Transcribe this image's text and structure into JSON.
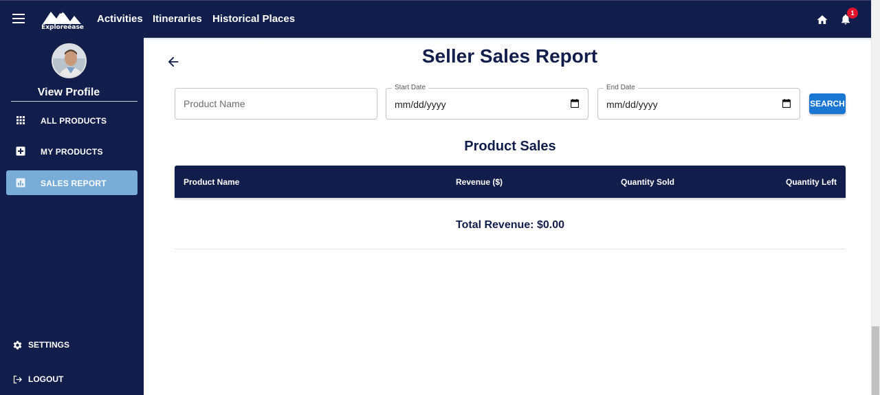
{
  "header": {
    "logo_text": "Exploreéase",
    "nav": [
      "Activities",
      "Itineraries",
      "Historical Places"
    ],
    "notification_count": "1"
  },
  "sidebar": {
    "profile_label": "View Profile",
    "items": [
      {
        "label": "ALL PRODUCTS",
        "icon": "grid-icon"
      },
      {
        "label": "MY PRODUCTS",
        "icon": "add-box-icon"
      },
      {
        "label": "SALES REPORT",
        "icon": "bar-chart-icon",
        "active": true
      }
    ],
    "settings_label": "SETTINGS",
    "logout_label": "LOGOUT"
  },
  "main": {
    "title": "Seller Sales Report",
    "filters": {
      "product_placeholder": "Product Name",
      "start_label": "Start Date",
      "start_value": "mm/dd/yyyy",
      "end_label": "End Date",
      "end_value": "mm/dd/yyyy",
      "search_label": "SEARCH"
    },
    "section_title": "Product Sales",
    "columns": [
      "Product Name",
      "Revenue ($)",
      "Quantity Sold",
      "Quantity Left"
    ],
    "total_revenue": "Total Revenue: $0.00"
  },
  "colors": {
    "navy": "#111d4a",
    "active_item": "#79acd6",
    "primary_button": "#1976d2",
    "badge": "#e2142d"
  }
}
